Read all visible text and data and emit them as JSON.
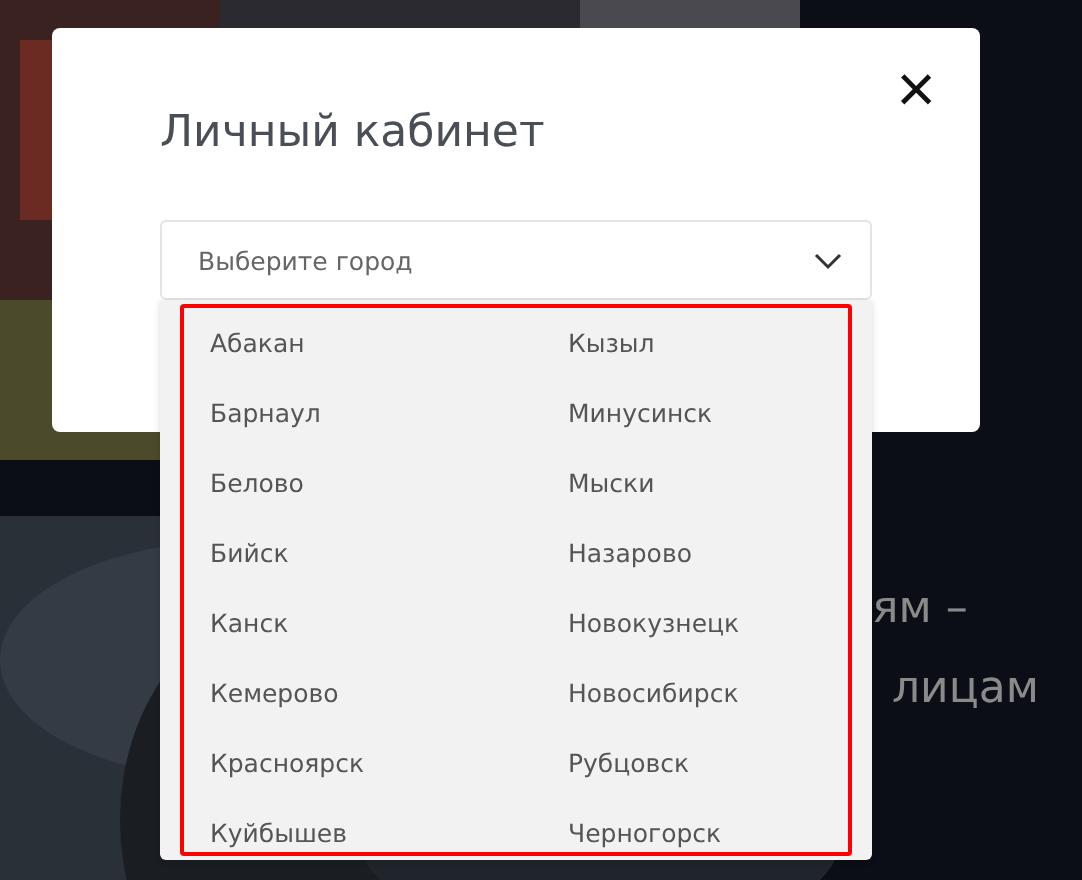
{
  "background_text": [
    "ям –",
    "лицам"
  ],
  "modal": {
    "title": "Личный кабинет",
    "close": "×"
  },
  "city_select": {
    "placeholder": "Выберите город",
    "expanded": true,
    "highlighted": true,
    "options": [
      "Абакан",
      "Барнаул",
      "Белово",
      "Бийск",
      "Канск",
      "Кемерово",
      "Красноярск",
      "Куйбышев",
      "Кызыл",
      "Минусинск",
      "Мыски",
      "Назарово",
      "Новокузнецк",
      "Новосибирск",
      "Рубцовск",
      "Черногорск"
    ]
  }
}
